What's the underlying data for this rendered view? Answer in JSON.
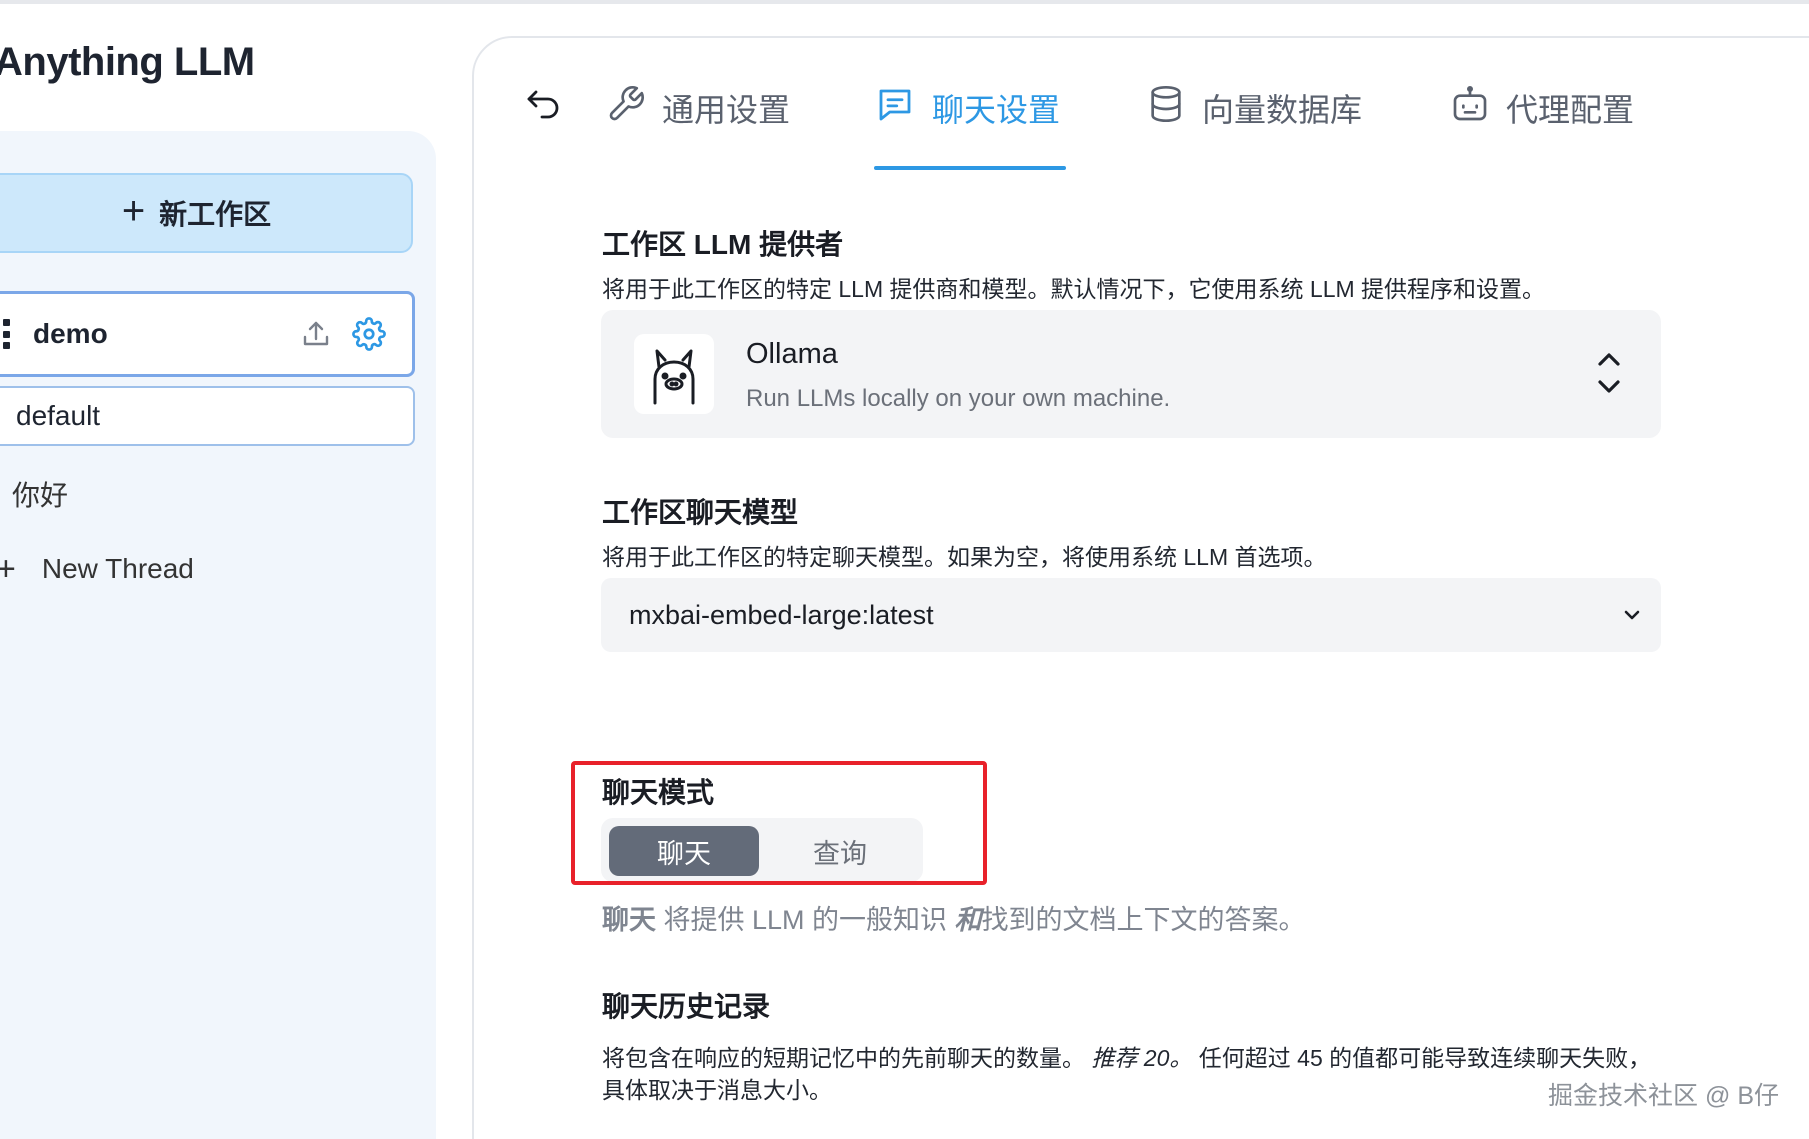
{
  "app": {
    "title": "Anything LLM"
  },
  "sidebar": {
    "new_workspace_label": "新工作区",
    "workspace": {
      "name": "demo"
    },
    "threads": [
      {
        "label": "default"
      },
      {
        "label": "你好"
      }
    ],
    "new_thread_label": "New Thread"
  },
  "tabs": [
    {
      "label": "通用设置",
      "icon": "wrench-icon",
      "active": false
    },
    {
      "label": "聊天设置",
      "icon": "chat-icon",
      "active": true
    },
    {
      "label": "向量数据库",
      "icon": "database-icon",
      "active": false
    },
    {
      "label": "代理配置",
      "icon": "robot-icon",
      "active": false
    }
  ],
  "llm_provider": {
    "title": "工作区 LLM 提供者",
    "description": "将用于此工作区的特定 LLM 提供商和模型。默认情况下，它使用系统 LLM 提供程序和设置。",
    "selected_name": "Ollama",
    "selected_desc": "Run LLMs locally on your own machine."
  },
  "chat_model": {
    "title": "工作区聊天模型",
    "description": "将用于此工作区的特定聊天模型。如果为空，将使用系统 LLM 首选项。",
    "value": "mxbai-embed-large:latest"
  },
  "chat_mode": {
    "title": "聊天模式",
    "options": [
      "聊天",
      "查询"
    ],
    "selected": "聊天",
    "help_bold": "聊天",
    "help_part1": " 将提供 LLM 的一般知识 ",
    "help_italic": "和",
    "help_part2": "找到的文档上下文的答案。"
  },
  "chat_history": {
    "title": "聊天历史记录",
    "desc_part1": "将包含在响应的短期记忆中的先前聊天的数量。",
    "desc_italic": "推荐 20。",
    "desc_part2": " 任何超过 45 的值都可能导致连续聊天失败，具体取决于消息大小。"
  },
  "watermark": "掘金技术社区 @ B仔",
  "colors": {
    "accent": "#2d98e4",
    "highlight": "#e8212a",
    "toggle_active": "#636b79"
  }
}
